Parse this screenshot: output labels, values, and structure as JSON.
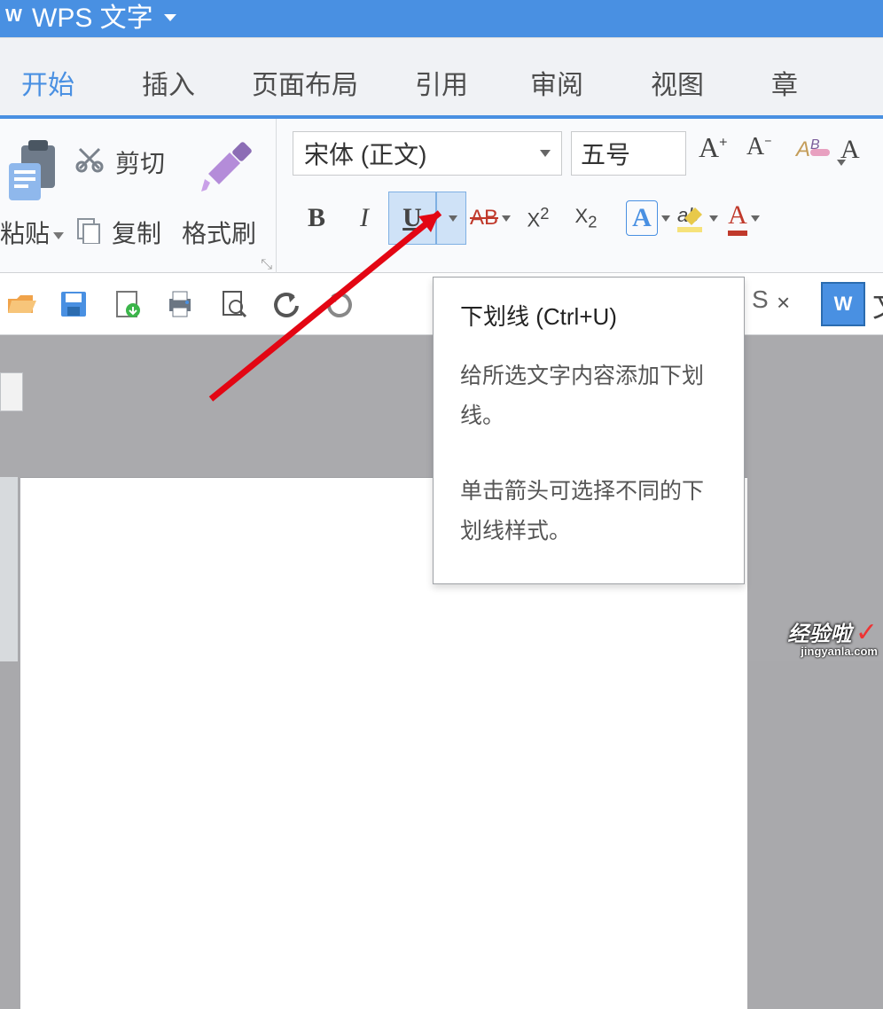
{
  "title_bar": {
    "app_name": "WPS 文字"
  },
  "tabs": {
    "t0": "开始",
    "t1": "插入",
    "t2": "页面布局",
    "t3": "引用",
    "t4": "审阅",
    "t5": "视图",
    "t6": "章"
  },
  "clipboard": {
    "paste": "粘贴",
    "cut": "剪切",
    "copy": "复制",
    "format_painter": "格式刷"
  },
  "font": {
    "name": "宋体 (正文)",
    "size": "五号",
    "grow": "A⁺",
    "shrink": "A⁻",
    "bold": "B",
    "italic": "I",
    "underline": "U",
    "strike": "AB",
    "sup_label": "X",
    "sub_label": "X",
    "text_effect": "A",
    "highlight": "A",
    "font_color": "A",
    "big_a": "A"
  },
  "tooltip": {
    "title": "下划线 (Ctrl+U)",
    "body": "给所选文字内容添加下划线。",
    "hint": "单击箭头可选择不同的下划线样式。"
  },
  "tab_close": {
    "letter": "S",
    "x": "×",
    "doc_letter": "W"
  },
  "watermark": {
    "main": "经验啦",
    "sub": "jingyanla.com",
    "check": "✓"
  }
}
